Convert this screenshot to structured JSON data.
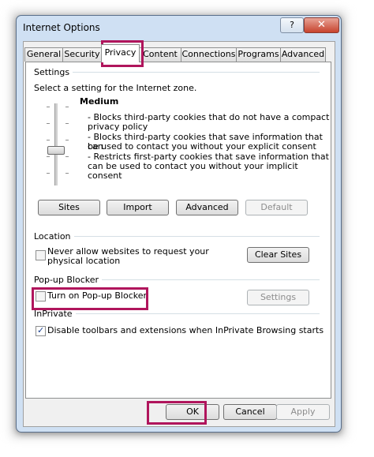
{
  "window": {
    "title": "Internet Options",
    "help": "?",
    "close": "✕"
  },
  "tabs": [
    "General",
    "Security",
    "Privacy",
    "Content",
    "Connections",
    "Programs",
    "Advanced"
  ],
  "settings": {
    "group_label": "Settings",
    "instruction": "Select a setting for the Internet zone.",
    "level": "Medium",
    "desc": [
      "- Blocks third-party cookies that do not have a compact",
      "privacy policy",
      "- Blocks third-party cookies that save information that can",
      "be used to contact you without your explicit consent",
      "- Restricts first-party cookies that save information that",
      "can be used to contact you without your implicit consent"
    ],
    "buttons": {
      "sites": "Sites",
      "import": "Import",
      "advanced": "Advanced",
      "default": "Default"
    }
  },
  "location": {
    "group_label": "Location",
    "checkbox_line1": "Never allow websites to request your",
    "checkbox_line2": "physical location",
    "checked": false,
    "clear_sites": "Clear Sites"
  },
  "popup": {
    "group_label": "Pop-up Blocker",
    "checkbox": "Turn on Pop-up Blocker",
    "checked": false,
    "settings": "Settings"
  },
  "inprivate": {
    "group_label": "InPrivate",
    "checkbox": "Disable toolbars and extensions when InPrivate Browsing starts",
    "checked": true
  },
  "footer": {
    "ok": "OK",
    "cancel": "Cancel",
    "apply": "Apply"
  },
  "colors": {
    "highlight": "#b0155c",
    "window_frame": "#cfe0f3"
  }
}
